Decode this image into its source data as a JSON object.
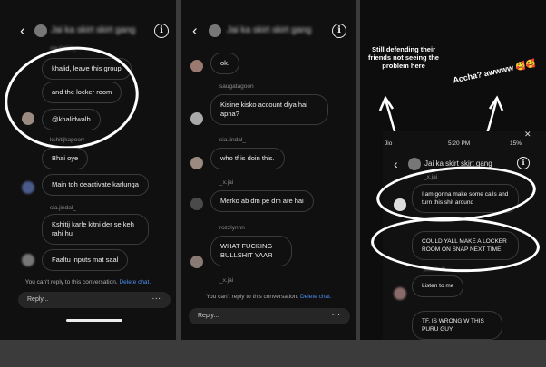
{
  "panel1": {
    "back_icon": "‹",
    "group_title": "Jai ka skirt skirt gang",
    "info_icon": "i",
    "messages": [
      {
        "username": "sia.jindal_",
        "text": "khalid, leave this group"
      },
      {
        "text": "and the locker room"
      },
      {
        "text": "@khalidwalb"
      },
      {
        "username": "kshitijkapoorr",
        "text": "Bhai oye"
      },
      {
        "text": "Main toh deactivate karlunga"
      },
      {
        "username": "sia.jindal_",
        "text": "Kshitij karle kitni der se keh rahi hu"
      },
      {
        "text": "Faaltu inputs mat saal"
      }
    ],
    "footer_text": "You can't reply to this conversation.",
    "footer_link": "Delete chat.",
    "reply_placeholder": "Reply...",
    "reply_more": "···"
  },
  "panel2": {
    "back_icon": "‹",
    "group_title": "Jai ka skirt skirt gang",
    "info_icon": "i",
    "messages": [
      {
        "text": "ok."
      },
      {
        "username": "saugatagoon",
        "text": "Kisine kisko account diya hai apna?"
      },
      {
        "username": "sia.jindal_",
        "text": "who tf is doin this."
      },
      {
        "username": "_x.jai",
        "text": "Merko ab dm pe dm are hai"
      },
      {
        "username": "rozzlynnn",
        "text": "WHAT FUCKING BULLSHIT YAAR"
      },
      {
        "username": "_x.jai",
        "text": ""
      }
    ],
    "footer_text": "You can't reply to this conversation.",
    "footer_link": "Delete chat.",
    "reply_placeholder": "Reply...",
    "reply_more": "···"
  },
  "panel3": {
    "annotation_left": "Still defending their friends not seeing the problem here",
    "annotation_right": "Accha? awwww 🥰🥰",
    "close_icon": "✕",
    "status_carrier": "Jio",
    "status_time": "5:20 PM",
    "status_battery": "15%",
    "back_icon": "‹",
    "group_title": "Jai ka skirt skirt gang",
    "info_icon": "i",
    "messages": [
      {
        "username": "_x.jai",
        "text": "I am gonna make some calls and turn this shit around"
      },
      {
        "text": "COULD YALL MAKE A LOCKER ROOM ON SNAP NEXT TIME"
      },
      {
        "username": "jicanhub",
        "text": "Listen to me"
      },
      {
        "text": "TF. IS WRONG W THIS PURU GUY"
      }
    ]
  }
}
